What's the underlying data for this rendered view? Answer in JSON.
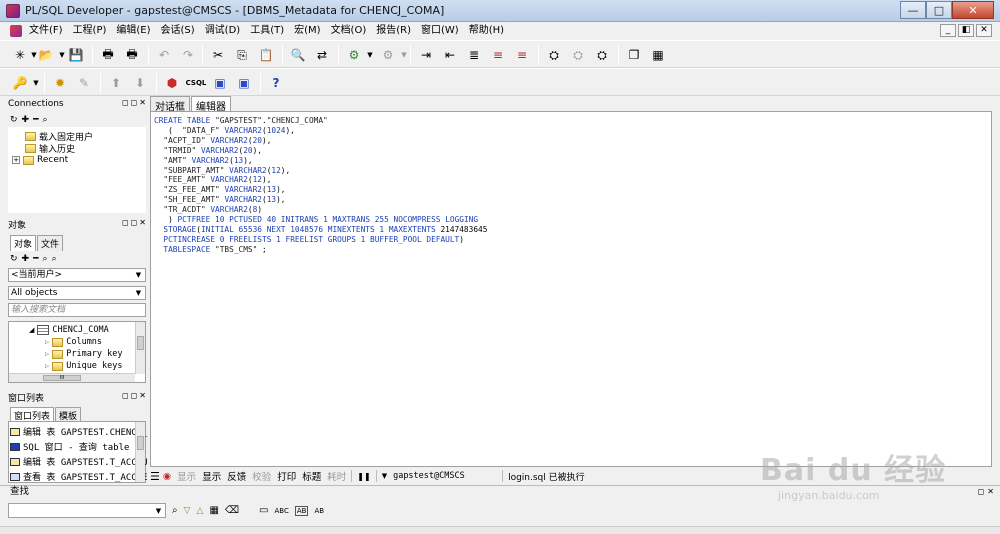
{
  "window": {
    "title": "PL/SQL Developer - gapstest@CMSCS - [DBMS_Metadata for CHENCJ_COMA]",
    "minimize": "—",
    "maximize": "□",
    "close": "✕"
  },
  "menu": {
    "items": [
      "文件(F)",
      "工程(P)",
      "编辑(E)",
      "会话(S)",
      "调试(D)",
      "工具(T)",
      "宏(M)",
      "文档(O)",
      "报告(R)",
      "窗口(W)",
      "帮助(H)"
    ],
    "mdi": [
      "_",
      "◧",
      "✕"
    ]
  },
  "connections": {
    "title": "Connections",
    "items": [
      "载入固定用户",
      "输入历史",
      "Recent"
    ]
  },
  "objects": {
    "title": "对象",
    "tabs": [
      "对象",
      "文件"
    ],
    "user_combo": "<当前用户>",
    "filter_combo": "All objects",
    "search_placeholder": "输入搜索文档",
    "tree": {
      "table": "CHENCJ_COMA",
      "children": [
        "Columns",
        "Primary key",
        "Unique keys"
      ]
    },
    "hscroll_label": "III"
  },
  "window_list": {
    "title": "窗口列表",
    "tabs": [
      "窗口列表",
      "模板"
    ],
    "rows": [
      "编辑 表 GAPSTEST.CHENCJ_",
      "SQL 窗口 - 查询 table T_",
      "编辑 表 GAPSTEST.T_ACCOU",
      "查看 表 GAPSTEST.T_ACCDE"
    ]
  },
  "editor": {
    "tabs": [
      "对话框",
      "编辑器"
    ],
    "active_tab": 1,
    "lines": [
      "CREATE TABLE \"GAPSTEST\".\"CHENCJ_COMA\"",
      "   (  \"DATA_F\" VARCHAR2(1024),",
      "  \"ACPT_ID\" VARCHAR2(20),",
      "  \"TRMID\" VARCHAR2(20),",
      "  \"AMT\" VARCHAR2(13),",
      "  \"SUBPART_AMT\" VARCHAR2(12),",
      "  \"FEE_AMT\" VARCHAR2(12),",
      "  \"ZS_FEE_AMT\" VARCHAR2(13),",
      "  \"SH_FEE_AMT\" VARCHAR2(13),",
      "  \"TR_ACDT\" VARCHAR2(8)",
      "   ) PCTFREE 10 PCTUSED 40 INITRANS 1 MAXTRANS 255 NOCOMPRESS LOGGING",
      "  STORAGE(INITIAL 65536 NEXT 1048576 MINEXTENTS 1 MAXEXTENTS 2147483645",
      "  PCTINCREASE 0 FREELISTS 1 FREELIST GROUPS 1 BUFFER_POOL DEFAULT)",
      "  TABLESPACE \"TBS_CMS\" ;"
    ]
  },
  "statusline": {
    "items": [
      "显示",
      "显示",
      "反馈",
      "校验",
      "打印",
      "标题",
      "耗时"
    ],
    "connection": "gapstest@CMSCS",
    "message": "login.sql 已被执行"
  },
  "find": {
    "title": "查找",
    "icons": [
      "binoculars-icon",
      "find-next-icon",
      "find-prev-icon",
      "highlight-icon",
      "clear-icon",
      "selection-icon",
      "case-icon",
      "whole-word-icon",
      "regex-icon"
    ],
    "labels": [
      "ABC",
      "AB",
      "AB"
    ]
  },
  "watermark": {
    "main": "Bai du 经验",
    "url": "jingyan.baidu.com"
  }
}
